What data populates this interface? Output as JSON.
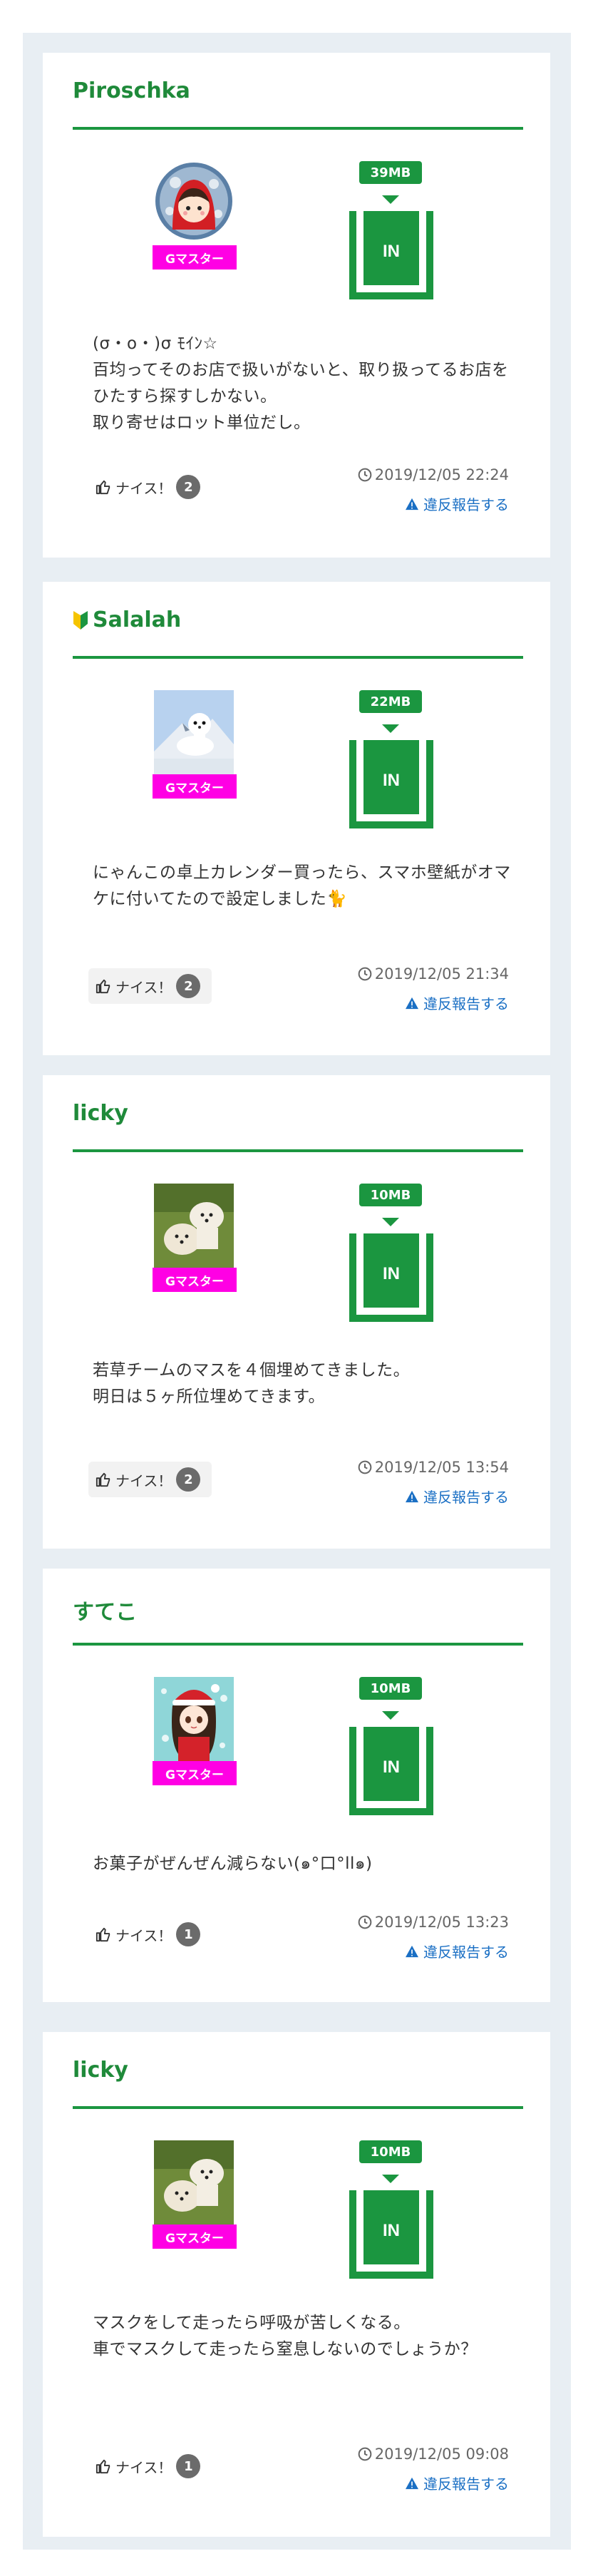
{
  "posts": [
    {
      "user": "Piroschka",
      "rank_label": "Gマスター",
      "size_label": "39MB",
      "in_label": "IN",
      "text": "(σ・ο・)σ ﾓｲﾝ☆\n百均ってそのお店で扱いがないと、取り扱ってるお店をひたすら探すしかない。\n取り寄せはロット単位だし。",
      "nice_label": "ナイス！",
      "nice_count": "2",
      "time": "2019/12/05 22:24",
      "report_label": "違反報告する",
      "avatar": "red-hood-girl"
    },
    {
      "user": "Salalah",
      "rank_label": "Gマスター",
      "size_label": "22MB",
      "in_label": "IN",
      "text": "にゃんこの卓上カレンダー買ったら、スマホ壁紙がオマケに付いてたので設定しました🐈",
      "nice_label": "ナイス！",
      "nice_count": "2",
      "time": "2019/12/05 21:34",
      "report_label": "違反報告する",
      "avatar": "white-weasel-mountain"
    },
    {
      "user": "licky",
      "rank_label": "Gマスター",
      "size_label": "10MB",
      "in_label": "IN",
      "text": "若草チームのマスを４個埋めてきました。\n明日は５ヶ所位埋めてきます。",
      "nice_label": "ナイス！",
      "nice_count": "2",
      "time": "2019/12/05 13:54",
      "report_label": "違反報告する",
      "avatar": "white-dogs-grass"
    },
    {
      "user": "すてこ",
      "rank_label": "Gマスター",
      "size_label": "10MB",
      "in_label": "IN",
      "text": "お菓子がぜんぜん減らない(๑°口°ll๑)",
      "nice_label": "ナイス！",
      "nice_count": "1",
      "time": "2019/12/05 13:23",
      "report_label": "違反報告する",
      "avatar": "santa-girl"
    },
    {
      "user": "licky",
      "rank_label": "Gマスター",
      "size_label": "10MB",
      "in_label": "IN",
      "text": "マスクをして走ったら呼吸が苦しくなる。\n車でマスクして走ったら窒息しないのでしょうか？",
      "nice_label": "ナイス！",
      "nice_count": "1",
      "time": "2019/12/05 09:08",
      "report_label": "違反報告する",
      "avatar": "white-dogs-grass"
    }
  ],
  "icons": {
    "thumb": "thumbs-up-icon",
    "clock": "clock-icon",
    "warning": "warning-icon",
    "beginner": "beginner-mark-icon"
  },
  "colors": {
    "accent_green": "#1b9640",
    "name_green": "#1f8a3a",
    "badge_magenta": "#ff00e4",
    "link_blue": "#1a6fc4",
    "feed_bg": "#e8eef3"
  }
}
